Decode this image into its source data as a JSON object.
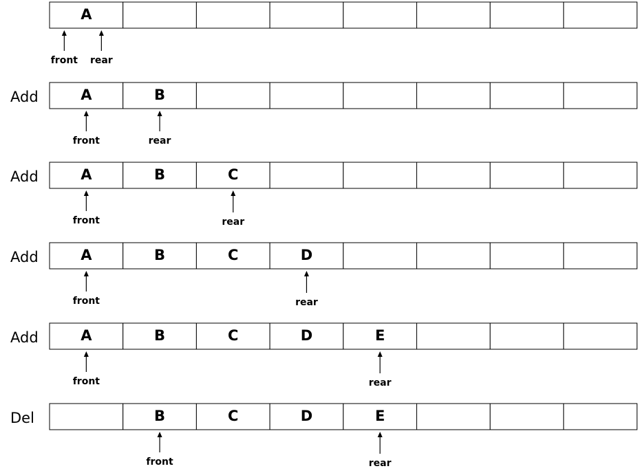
{
  "rows": [
    {
      "op": "",
      "cells": [
        "A",
        "",
        "",
        "",
        "",
        "",
        "",
        ""
      ],
      "pointers": [
        {
          "label": "front",
          "index": 0
        },
        {
          "label": "rear",
          "index": 0
        }
      ]
    },
    {
      "op": "Add",
      "cells": [
        "A",
        "B",
        "",
        "",
        "",
        "",
        "",
        ""
      ],
      "pointers": [
        {
          "label": "front",
          "index": 0
        },
        {
          "label": "rear",
          "index": 1
        }
      ]
    },
    {
      "op": "Add",
      "cells": [
        "A",
        "B",
        "C",
        "",
        "",
        "",
        "",
        ""
      ],
      "pointers": [
        {
          "label": "front",
          "index": 0
        },
        {
          "label": "rear",
          "index": 2
        }
      ]
    },
    {
      "op": "Add",
      "cells": [
        "A",
        "B",
        "C",
        "D",
        "",
        "",
        "",
        ""
      ],
      "pointers": [
        {
          "label": "front",
          "index": 0
        },
        {
          "label": "rear",
          "index": 3
        }
      ]
    },
    {
      "op": "Add",
      "cells": [
        "A",
        "B",
        "C",
        "D",
        "E",
        "",
        "",
        ""
      ],
      "pointers": [
        {
          "label": "front",
          "index": 0
        },
        {
          "label": "rear",
          "index": 4
        }
      ]
    },
    {
      "op": "Del",
      "cells": [
        "",
        "B",
        "C",
        "D",
        "E",
        "",
        "",
        ""
      ],
      "pointers": [
        {
          "label": "front",
          "index": 1
        },
        {
          "label": "rear",
          "index": 4
        }
      ]
    }
  ]
}
